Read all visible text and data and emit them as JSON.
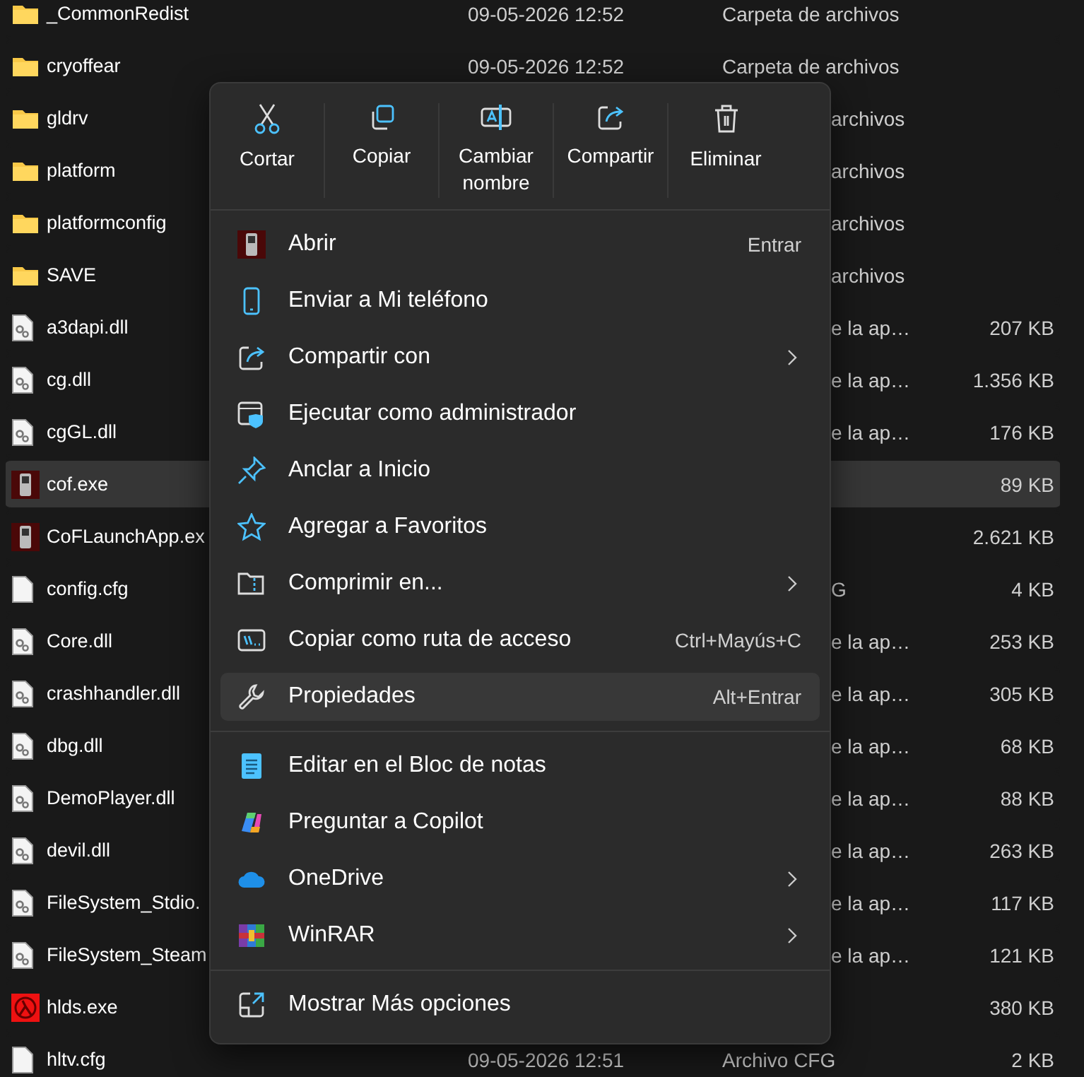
{
  "files": [
    {
      "kind": "folder",
      "name": "_CommonRedist",
      "date": "09-05-2026 12:52",
      "type": "Carpeta de archivos",
      "selected": false
    },
    {
      "kind": "folder",
      "name": "cryoffear",
      "date": "09-05-2026 12:52",
      "type": "Carpeta de archivos",
      "selected": false
    },
    {
      "kind": "folder",
      "name": "gldrv",
      "type_partial": "archivos",
      "selected": false
    },
    {
      "kind": "folder",
      "name": "platform",
      "type_partial": "archivos",
      "selected": false
    },
    {
      "kind": "folder",
      "name": "platformconfig",
      "type_partial": "archivos",
      "selected": false
    },
    {
      "kind": "folder",
      "name": "SAVE",
      "type_partial": "archivos",
      "selected": false
    },
    {
      "kind": "library",
      "name": "a3dapi.dll",
      "type_partial": "e la ap…",
      "size": "207 KB",
      "selected": false
    },
    {
      "kind": "library",
      "name": "cg.dll",
      "type_partial": "e la ap…",
      "size": "1.356 KB",
      "selected": false
    },
    {
      "kind": "library",
      "name": "cgGL.dll",
      "type_partial": "e la ap…",
      "size": "176 KB",
      "selected": false
    },
    {
      "kind": "app",
      "name": "cof.exe",
      "size": "89 KB",
      "selected": true
    },
    {
      "kind": "app",
      "name": "CoFLaunchApp.ex",
      "size": "2.621 KB",
      "selected": false
    },
    {
      "kind": "text",
      "name": "config.cfg",
      "type_partial": "G",
      "size": "4 KB",
      "selected": false
    },
    {
      "kind": "library",
      "name": "Core.dll",
      "type_partial": "e la ap…",
      "size": "253 KB",
      "selected": false
    },
    {
      "kind": "library",
      "name": "crashhandler.dll",
      "type_partial": "e la ap…",
      "size": "305 KB",
      "selected": false
    },
    {
      "kind": "library",
      "name": "dbg.dll",
      "type_partial": "e la ap…",
      "size": "68 KB",
      "selected": false
    },
    {
      "kind": "library",
      "name": "DemoPlayer.dll",
      "type_partial": "e la ap…",
      "size": "88 KB",
      "selected": false
    },
    {
      "kind": "library",
      "name": "devil.dll",
      "type_partial": "e la ap…",
      "size": "263 KB",
      "selected": false
    },
    {
      "kind": "library",
      "name": "FileSystem_Stdio.",
      "type_partial": "e la ap…",
      "size": "117 KB",
      "selected": false
    },
    {
      "kind": "library",
      "name": "FileSystem_Steam",
      "type_partial": "e la ap…",
      "size": "121 KB",
      "selected": false
    },
    {
      "kind": "game",
      "name": "hlds.exe",
      "size": "380 KB",
      "selected": false
    },
    {
      "kind": "text",
      "name": "hltv.cfg",
      "date": "09-05-2026 12:51",
      "type": "Archivo CFG",
      "size": "2 KB",
      "selected": false
    }
  ],
  "context_menu": {
    "actions": [
      {
        "kind": "cut",
        "label": "Cortar"
      },
      {
        "kind": "copy",
        "label": "Copiar"
      },
      {
        "kind": "rename",
        "label": "Cambiar nombre"
      },
      {
        "kind": "share",
        "label": "Compartir"
      },
      {
        "kind": "delete",
        "label": "Eliminar"
      }
    ],
    "sections": [
      [
        {
          "kind": "app",
          "label": "Abrir",
          "shortcut": "Entrar",
          "submenu": false,
          "selected": false
        },
        {
          "kind": "phone",
          "label": "Enviar a Mi teléfono",
          "submenu": false,
          "selected": false
        },
        {
          "kind": "share",
          "label": "Compartir con",
          "submenu": true,
          "selected": false
        },
        {
          "kind": "shield",
          "label": "Ejecutar como administrador",
          "submenu": false,
          "selected": false
        },
        {
          "kind": "pin",
          "label": "Anclar a Inicio",
          "submenu": false,
          "selected": false
        },
        {
          "kind": "star",
          "label": "Agregar a Favoritos",
          "submenu": false,
          "selected": false
        },
        {
          "kind": "zip",
          "label": "Comprimir en...",
          "submenu": true,
          "selected": false
        },
        {
          "kind": "path",
          "label": "Copiar como ruta de acceso",
          "shortcut": "Ctrl+Mayús+C",
          "submenu": false,
          "selected": false
        },
        {
          "kind": "wrench",
          "label": "Propiedades",
          "shortcut": "Alt+Entrar",
          "submenu": false,
          "selected": true
        }
      ],
      [
        {
          "kind": "notepad",
          "label": "Editar en el Bloc de notas",
          "submenu": false,
          "selected": false
        },
        {
          "kind": "copilot",
          "label": "Preguntar a Copilot",
          "submenu": false,
          "selected": false
        },
        {
          "kind": "cloud",
          "label": "OneDrive",
          "submenu": true,
          "selected": false
        },
        {
          "kind": "archive",
          "label": "WinRAR",
          "submenu": true,
          "selected": false
        }
      ],
      [
        {
          "kind": "more",
          "label": "Mostrar Más opciones",
          "submenu": false,
          "selected": false
        }
      ]
    ]
  }
}
